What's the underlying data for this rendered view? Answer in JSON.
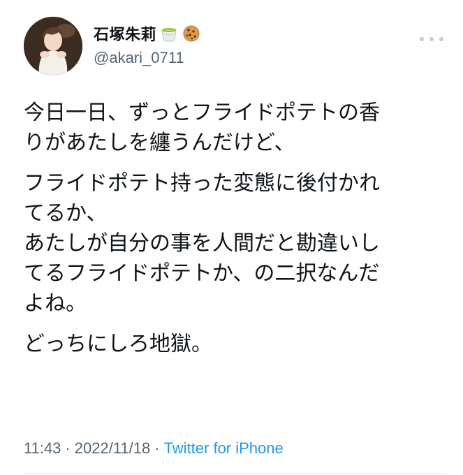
{
  "tweet": {
    "author": {
      "display_name": "石塚朱莉",
      "emojis": [
        "green-tea-icon",
        "cookie-icon"
      ],
      "handle": "@akari_0711"
    },
    "paragraphs": [
      "今日一日、ずっとフライドポテトの香\nりがあたしを纏うんだけど、",
      "フライドポテト持った変態に後付かれ\nてるか、\nあたしが自分の事を人間だと勘違いし\nてるフライドポテトか、の二択なんだ\nよね。",
      "どっちにしろ地獄。"
    ],
    "time": "11:43",
    "separator": "·",
    "date": "2022/11/18",
    "source": "Twitter for iPhone"
  },
  "colors": {
    "text": "#0f1419",
    "muted": "#536471",
    "link": "#1d9bf0"
  }
}
